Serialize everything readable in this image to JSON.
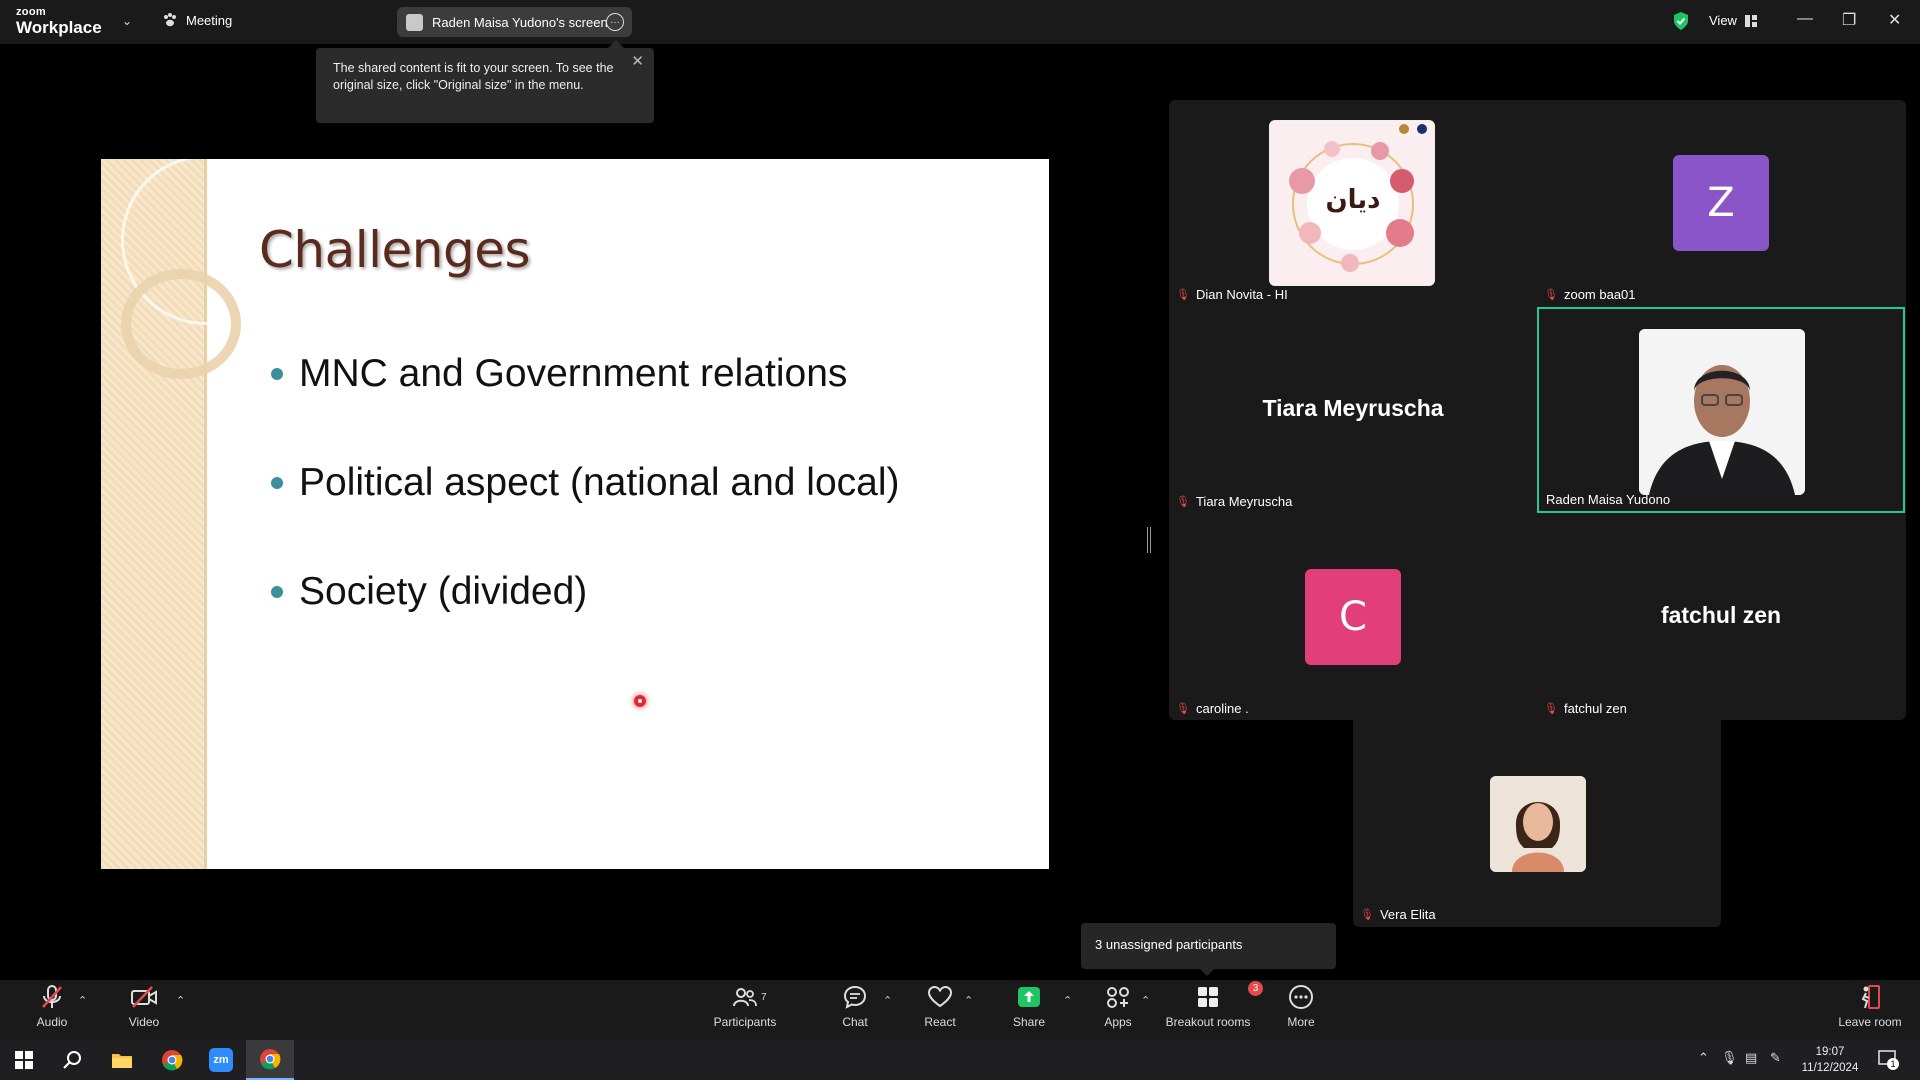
{
  "app": {
    "logo_top": "zoom",
    "logo_bottom": "Workplace",
    "meeting_label": "Meeting",
    "share_pill": "Raden Maisa Yudono's screen",
    "view_label": "View"
  },
  "tooltip": {
    "text": "The shared content is fit to your screen. To see the original size, click \"Original size\" in the menu."
  },
  "slide": {
    "title": "Challenges",
    "bullets": [
      "MNC and Government relations",
      "Political aspect (national and local)",
      "Society (divided)"
    ],
    "accent": "#3d8f9c"
  },
  "participants": {
    "tiles": [
      {
        "name": "Dian Novita - HI",
        "avatar_text": "ديان",
        "muted": true
      },
      {
        "name": "zoom baa01",
        "avatar_letter": "Z",
        "avatar_color": "#8a55c9",
        "muted": true
      },
      {
        "name": "Tiara Meyruscha",
        "display_name": "Tiara Meyruscha",
        "muted": true
      },
      {
        "name": "Raden Maisa Yudono",
        "muted": false,
        "active_speaker": true
      },
      {
        "name": "caroline .",
        "avatar_letter": "C",
        "avatar_color": "#e23f7a",
        "muted": true
      },
      {
        "name": "fatchul zen",
        "display_name": "fatchul zen",
        "muted": true
      },
      {
        "name": "Vera Elita",
        "muted": true
      }
    ],
    "unassigned": "3 unassigned participants"
  },
  "toolbar": {
    "audio": "Audio",
    "video": "Video",
    "participants": "Participants",
    "participants_count": "7",
    "chat": "Chat",
    "react": "React",
    "share": "Share",
    "apps": "Apps",
    "breakout": "Breakout rooms",
    "breakout_badge": "3",
    "more": "More",
    "leave": "Leave room",
    "share_color": "#1fc464"
  },
  "taskbar": {
    "time": "19:07",
    "date": "11/12/2024",
    "notifications": "1",
    "zoom_icon_text": "zm"
  }
}
